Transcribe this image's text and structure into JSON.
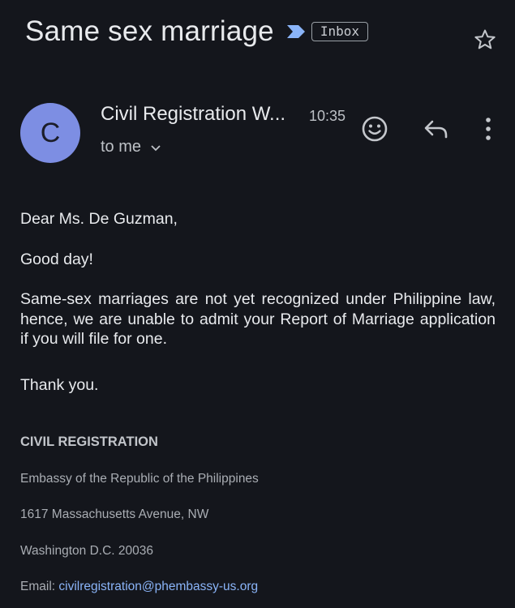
{
  "header": {
    "subject": "Same sex marriage",
    "label": "Inbox",
    "importance_icon": "importance-marker-icon",
    "star_icon": "star-outline-icon"
  },
  "sender": {
    "avatar_letter": "C",
    "avatar_color": "#7d8ee3",
    "name": "Civil Registration W...",
    "time": "10:35",
    "recipient": "to me"
  },
  "actions": {
    "react_icon": "emoji-icon",
    "reply_icon": "reply-icon",
    "more_icon": "more-vert-icon"
  },
  "message": {
    "greeting": "Dear Ms. De Guzman,",
    "opening": "Good day!",
    "paragraph": "Same-sex marriages are not yet recognized under Philippine law, hence, we are unable to admit your Report of Marriage application if you will file for one.",
    "closing": "Thank you."
  },
  "signature": {
    "title": "CIVIL REGISTRATION",
    "line1": "Embassy of the Republic of the Philippines",
    "line2": "1617 Massachusetts Avenue, NW",
    "line3": "Washington D.C. 20036",
    "email_label": "Email: ",
    "email": "civilregistration@phembassy-us.org"
  },
  "colors": {
    "background": "#14161c",
    "link": "#8ab4f8",
    "importance": "#8ab4f8"
  }
}
